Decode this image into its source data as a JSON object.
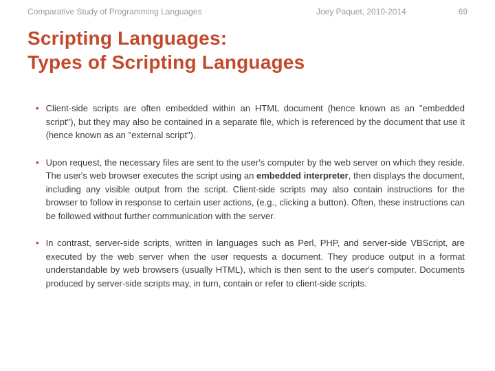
{
  "header": {
    "course": "Comparative Study of Programming Languages",
    "author": "Joey Paquet, 2010-2014",
    "page": "69"
  },
  "title_line1": "Scripting Languages:",
  "title_line2": "Types of Scripting Languages",
  "bullets": [
    {
      "pre": "Client-side scripts are often embedded within an HTML document (hence known as an \"embedded script\"), but they may also be contained in a separate file, which is referenced by the document that use it (hence known as an \"external script\").",
      "bold": "",
      "post": ""
    },
    {
      "pre": "Upon request, the necessary files are sent to the user's computer by the web server on which they reside. The user's web browser executes the script using an ",
      "bold": "embedded interpreter",
      "post": ", then displays the document, including any visible output from the script. Client-side scripts may also contain instructions for the browser to follow in response to certain user actions, (e.g., clicking a button). Often, these instructions can be followed without further communication with the server."
    },
    {
      "pre": "In contrast, server-side scripts, written in languages such as Perl, PHP, and server-side VBScript, are executed by the web server when the user requests a document. They produce output in a format understandable by web browsers (usually HTML), which is then sent to the user's computer. Documents produced by server-side scripts may, in turn, contain or refer to client-side scripts.",
      "bold": "",
      "post": ""
    }
  ]
}
